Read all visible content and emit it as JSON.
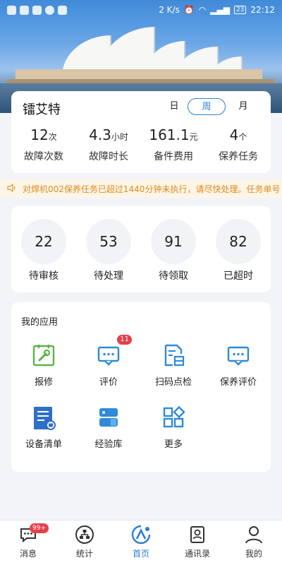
{
  "status_bar": {
    "network_speed": "2 K/s",
    "battery": "23",
    "time": "22:12"
  },
  "summary": {
    "title": "镭艾特",
    "periods": {
      "day": "日",
      "week": "周",
      "month": "月"
    },
    "stats": [
      {
        "value": "12",
        "unit": "次",
        "label": "故障次数"
      },
      {
        "value": "4.3",
        "unit": "小时",
        "label": "故障时长"
      },
      {
        "value": "161.1",
        "unit": "元",
        "label": "备件费用"
      },
      {
        "value": "4",
        "unit": "个",
        "label": "保养任务"
      }
    ]
  },
  "notice": {
    "text": "对焊机002保养任务已超过1440分钟未执行，请尽快处理。任务单号"
  },
  "counts": [
    {
      "value": "22",
      "label": "待审核"
    },
    {
      "value": "53",
      "label": "待处理"
    },
    {
      "value": "91",
      "label": "待领取"
    },
    {
      "value": "82",
      "label": "已超时"
    }
  ],
  "apps": {
    "title": "我的应用",
    "items": [
      {
        "label": "报修",
        "icon": "repair-icon"
      },
      {
        "label": "评价",
        "icon": "comment-icon",
        "badge": "11"
      },
      {
        "label": "扫码点检",
        "icon": "scan-check-icon"
      },
      {
        "label": "保养评价",
        "icon": "maintenance-comment-icon"
      },
      {
        "label": "设备清单",
        "icon": "equipment-list-icon"
      },
      {
        "label": "经验库",
        "icon": "experience-library-icon"
      },
      {
        "label": "更多",
        "icon": "more-grid-icon"
      }
    ]
  },
  "tabbar": {
    "items": [
      {
        "label": "消息",
        "icon": "message-icon",
        "badge": "99+"
      },
      {
        "label": "统计",
        "icon": "statistics-icon"
      },
      {
        "label": "首页",
        "icon": "home-icon"
      },
      {
        "label": "通讯录",
        "icon": "contacts-icon"
      },
      {
        "label": "我的",
        "icon": "profile-icon"
      }
    ]
  },
  "colors": {
    "accent": "#2a7fd6",
    "badge": "#e73f4a",
    "notice_text": "#e08a21",
    "app_green": "#5bb443",
    "app_blue": "#2f8ad8"
  }
}
